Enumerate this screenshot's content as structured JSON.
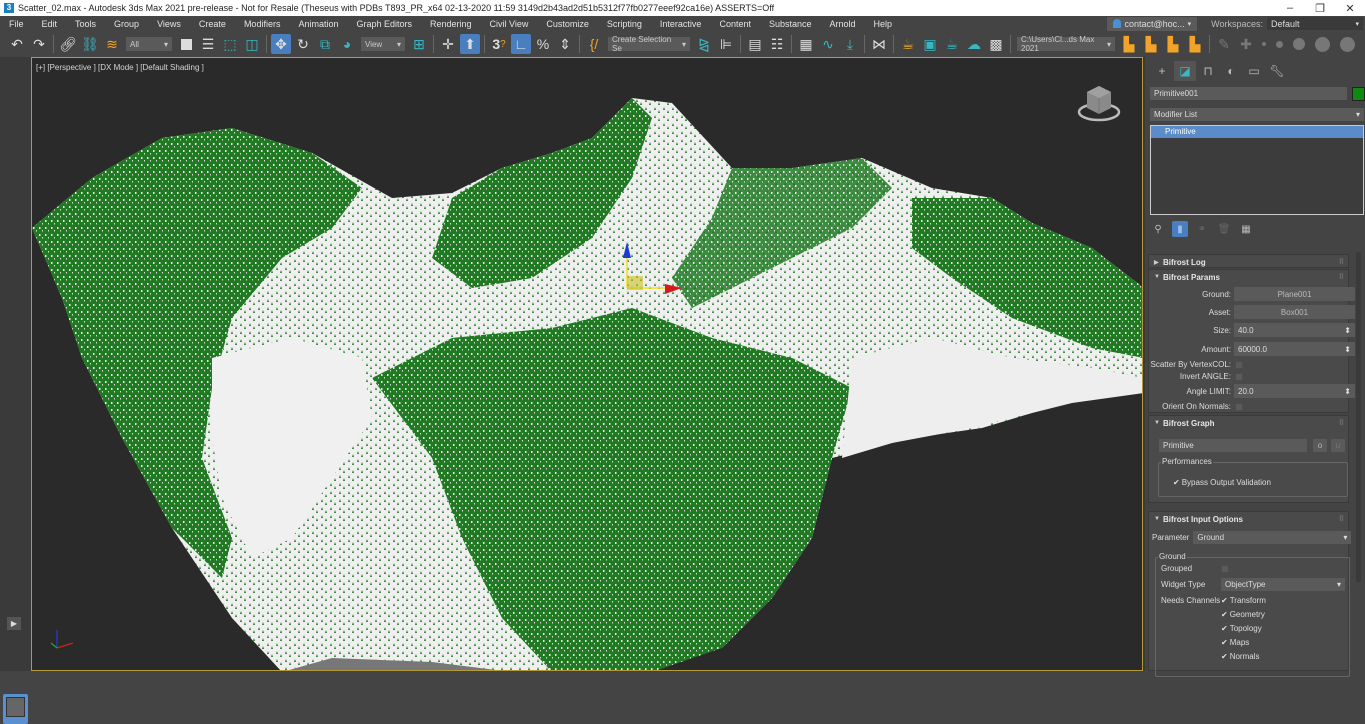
{
  "window": {
    "title": "Scatter_02.max - Autodesk 3ds Max 2021 pre-release - Not for Resale (Theseus with PDBs T893_PR_x64 02-13-2020 11:59 3149d2b43ad2d51b5312f77fb0277eeef92ca16e) ASSERTS=Off",
    "app_icon": "3",
    "minimize": "–",
    "maximize": "❐",
    "close": "✕"
  },
  "menu": {
    "items": [
      "File",
      "Edit",
      "Tools",
      "Group",
      "Views",
      "Create",
      "Modifiers",
      "Animation",
      "Graph Editors",
      "Rendering",
      "Civil View",
      "Customize",
      "Scripting",
      "Interactive",
      "Content",
      "Substance",
      "Arnold",
      "Help"
    ],
    "user": "contact@hoc...",
    "workspaces_label": "Workspaces:",
    "workspace": "Default"
  },
  "toolbar": {
    "selection_filter": "All",
    "ref_coord": "View",
    "named_selection": "Create Selection Se",
    "project_path": "C:\\Users\\Cl...ds Max 2021"
  },
  "viewport": {
    "label": "[+] [Perspective ] [DX Mode ] [Default Shading ]",
    "colors": {
      "snow": "#f2f2f2",
      "trees": "#1f7a22",
      "background": "#2a2a2a"
    }
  },
  "command_panel": {
    "object_name": "Primitive001",
    "object_color": "#0e8a12",
    "modifier_list": "Modifier List",
    "stack_items": [
      "Primitive"
    ],
    "rollouts": {
      "log": {
        "title": "Bifrost Log"
      },
      "params": {
        "title": "Bifrost Params",
        "ground_label": "Ground:",
        "ground": "Plane001",
        "asset_label": "Asset:",
        "asset": "Box001",
        "size_label": "Size:",
        "size": "40.0",
        "amount_label": "Amount:",
        "amount": "60000.0",
        "scatter_label": "Scatter By VertexCOL:",
        "invert_label": "Invert ANGLE:",
        "angle_label": "Angle LIMIT:",
        "angle": "20.0",
        "orient_label": "Orient On Normals:"
      },
      "graph": {
        "title": "Bifrost Graph",
        "graph_name": "Primitive",
        "open_btn": "o",
        "update_btn": "u",
        "performances": "Performances",
        "bypass": "Bypass Output Validation"
      },
      "input": {
        "title": "Bifrost Input Options",
        "parameter_label": "Parameter",
        "parameter": "Ground",
        "group_title": "Ground",
        "grouped_label": "Grouped",
        "widget_label": "Widget Type",
        "widget": "ObjectType",
        "channels_label": "Needs Channels",
        "channels": [
          "Transform",
          "Geometry",
          "Topology",
          "Maps",
          "Normals"
        ]
      }
    }
  }
}
